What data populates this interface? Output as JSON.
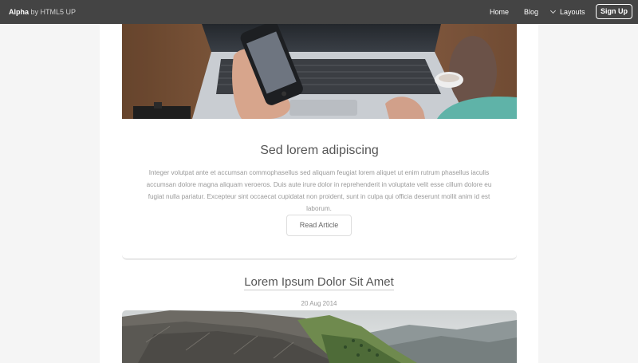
{
  "header": {
    "brand_strong": "Alpha",
    "brand_rest": "by HTML5 UP",
    "nav": {
      "home": "Home",
      "blog": "Blog",
      "layouts": "Layouts",
      "signup": "Sign Up"
    }
  },
  "article": {
    "title": "Sed lorem adipiscing",
    "body": "Integer volutpat ante et accumsan commophasellus sed aliquam feugiat lorem aliquet ut enim rutrum phasellus iaculis accumsan dolore magna aliquam veroeros. Duis aute irure dolor in reprehenderit in voluptate velit esse cillum dolore eu fugiat nulla pariatur. Excepteur sint occaecat cupidatat non proident, sunt in culpa qui officia deserunt mollit anim id est laborum.",
    "button": "Read Article"
  },
  "post": {
    "title": "Lorem Ipsum Dolor Sit Amet",
    "date": "20 Aug 2014"
  },
  "colors": {
    "topbar": "#444444",
    "page_bg": "#f5f5f5",
    "content_bg": "#ffffff",
    "title_text": "#555555",
    "body_text": "#999999"
  }
}
